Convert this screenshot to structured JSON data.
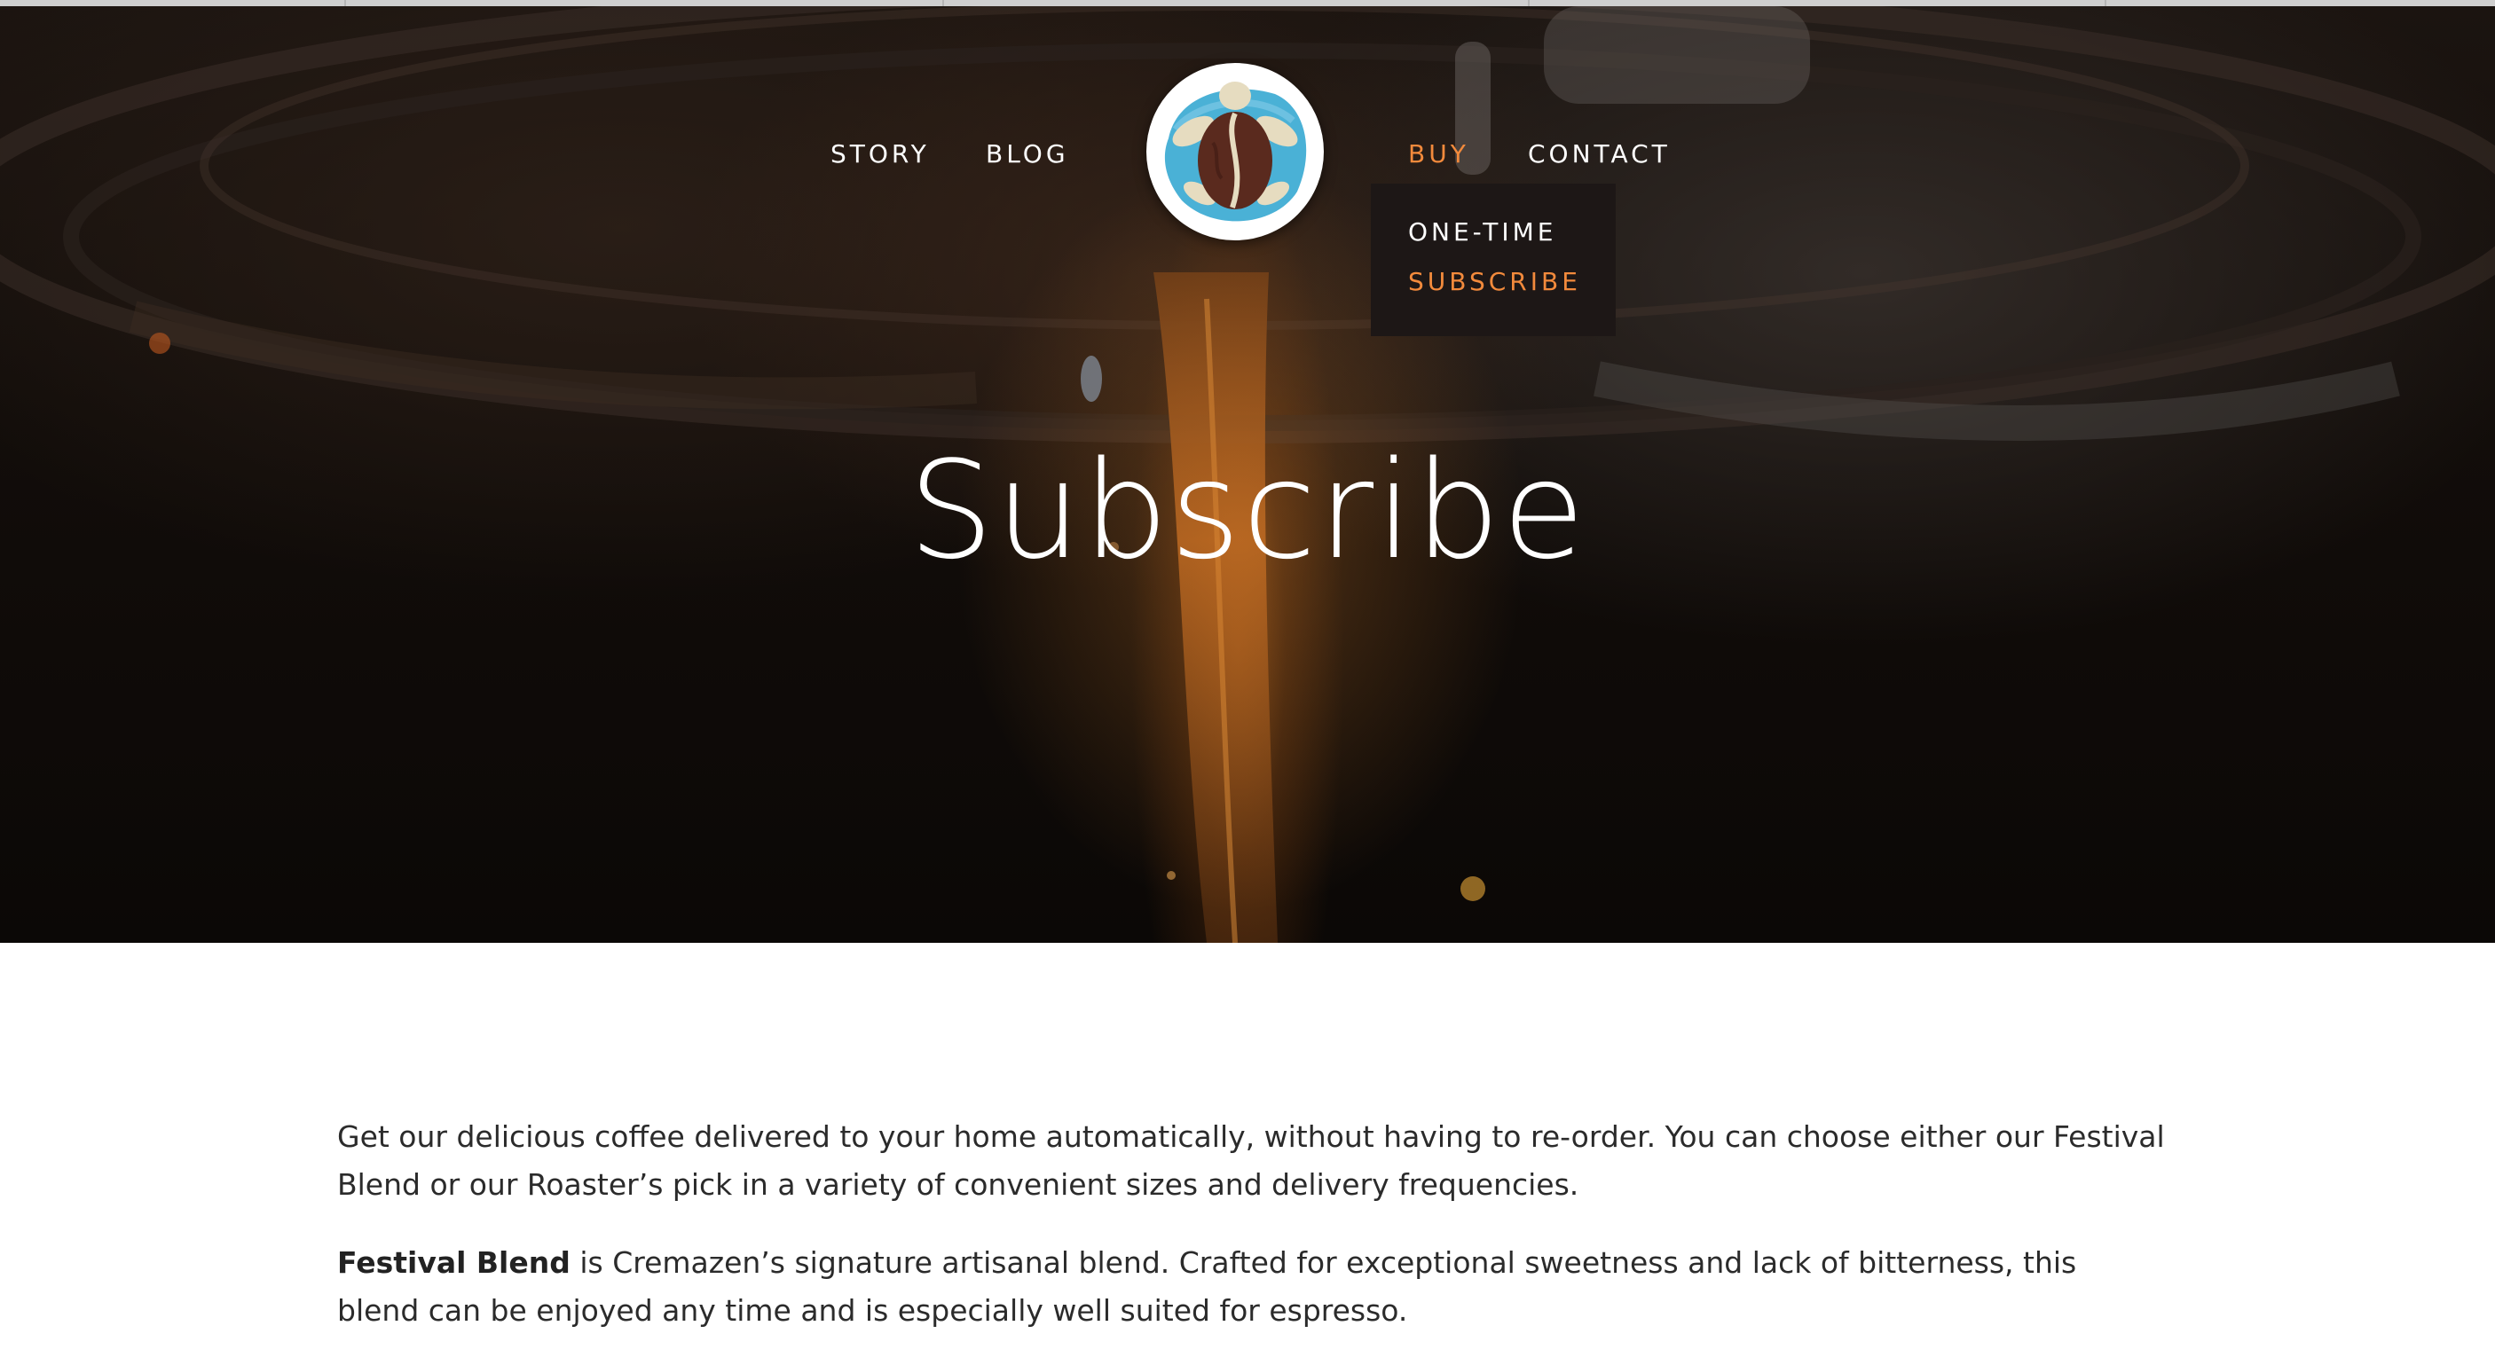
{
  "nav": {
    "left_links": [
      "STORY",
      "BLOG"
    ],
    "right_links": [
      "BUY",
      "CONTACT"
    ],
    "active_link": "BUY",
    "logo_icon": "turtle-coffee-bean-logo-icon"
  },
  "dropdown": {
    "items": [
      "ONE-TIME",
      "SUBSCRIBE"
    ],
    "active_item": "SUBSCRIBE"
  },
  "hero": {
    "title": "Subscribe"
  },
  "content": {
    "intro": "Get our delicious coffee delivered to your home automatically, without having to re-order. You can choose either our Festival Blend or our Roaster’s pick in a variety of convenient sizes and delivery frequencies.",
    "festival_name": "Festival Blend",
    "festival_text": " is Cremazen’s signature artisanal blend. Crafted for exceptional sweetness and lack of bitterness, this blend can be enjoyed any time and is especially well suited for espresso."
  },
  "colors": {
    "accent": "#f28a3c",
    "dropdown_bg": "#1d1716",
    "body_text": "#2b2b2b"
  }
}
